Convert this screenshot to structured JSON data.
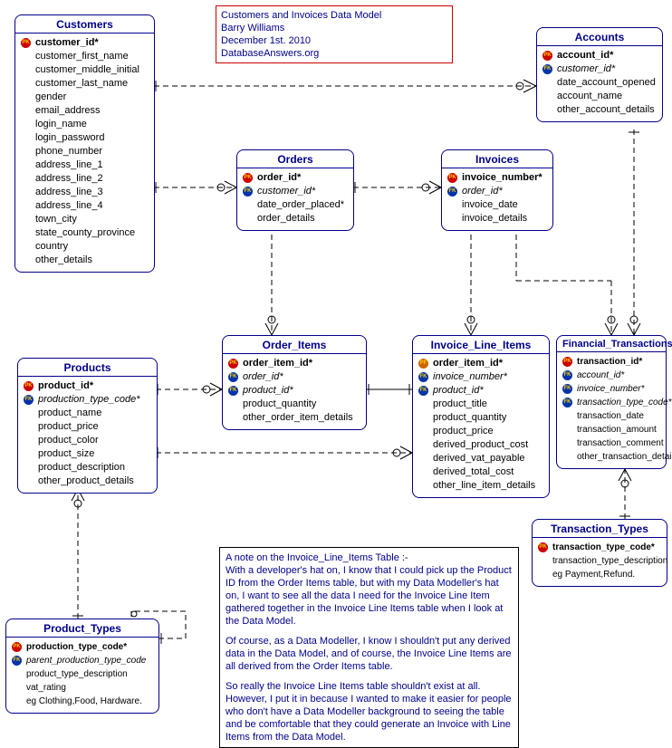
{
  "info": {
    "title": "Customers and Invoices Data Model",
    "author": "Barry Williams",
    "date": "December 1st. 2010",
    "site": "DatabaseAnswers.org"
  },
  "entities": {
    "customers": {
      "name": "Customers",
      "attrs": [
        {
          "k": "pk",
          "t": "customer_id*",
          "b": true
        },
        {
          "k": "",
          "t": "customer_first_name"
        },
        {
          "k": "",
          "t": "customer_middle_initial"
        },
        {
          "k": "",
          "t": "customer_last_name"
        },
        {
          "k": "",
          "t": "gender"
        },
        {
          "k": "",
          "t": "email_address"
        },
        {
          "k": "",
          "t": "login_name"
        },
        {
          "k": "",
          "t": "login_password"
        },
        {
          "k": "",
          "t": "phone_number"
        },
        {
          "k": "",
          "t": "address_line_1"
        },
        {
          "k": "",
          "t": "address_line_2"
        },
        {
          "k": "",
          "t": "address_line_3"
        },
        {
          "k": "",
          "t": "address_line_4"
        },
        {
          "k": "",
          "t": "town_city"
        },
        {
          "k": "",
          "t": "state_county_province"
        },
        {
          "k": "",
          "t": "country"
        },
        {
          "k": "",
          "t": "other_details"
        }
      ]
    },
    "accounts": {
      "name": "Accounts",
      "attrs": [
        {
          "k": "pk",
          "t": "account_id*",
          "b": true
        },
        {
          "k": "fk",
          "t": "customer_id*",
          "i": true
        },
        {
          "k": "",
          "t": "date_account_opened"
        },
        {
          "k": "",
          "t": "account_name"
        },
        {
          "k": "",
          "t": "other_account_details"
        }
      ]
    },
    "orders": {
      "name": "Orders",
      "attrs": [
        {
          "k": "pk",
          "t": "order_id*",
          "b": true
        },
        {
          "k": "fk",
          "t": "customer_id*",
          "i": true
        },
        {
          "k": "",
          "t": "date_order_placed*"
        },
        {
          "k": "",
          "t": "order_details"
        }
      ]
    },
    "invoices": {
      "name": "Invoices",
      "attrs": [
        {
          "k": "pk",
          "t": "invoice_number*",
          "b": true
        },
        {
          "k": "fk",
          "t": "order_id*",
          "i": true
        },
        {
          "k": "",
          "t": "invoice_date"
        },
        {
          "k": "",
          "t": "invoice_details"
        }
      ]
    },
    "products": {
      "name": "Products",
      "attrs": [
        {
          "k": "pk",
          "t": "product_id*",
          "b": true
        },
        {
          "k": "fk",
          "t": "production_type_code*",
          "i": true
        },
        {
          "k": "",
          "t": "product_name"
        },
        {
          "k": "",
          "t": "product_price"
        },
        {
          "k": "",
          "t": "product_color"
        },
        {
          "k": "",
          "t": "product_size"
        },
        {
          "k": "",
          "t": "product_description"
        },
        {
          "k": "",
          "t": "other_product_details"
        }
      ]
    },
    "order_items": {
      "name": "Order_Items",
      "attrs": [
        {
          "k": "pk",
          "t": "order_item_id*",
          "b": true
        },
        {
          "k": "fk",
          "t": "order_id*",
          "i": true
        },
        {
          "k": "fk",
          "t": "product_id*",
          "i": true
        },
        {
          "k": "",
          "t": "product_quantity"
        },
        {
          "k": "",
          "t": "other_order_item_details"
        }
      ]
    },
    "invoice_line_items": {
      "name": "Invoice_Line_Items",
      "attrs": [
        {
          "k": "pf",
          "t": "order_item_id*",
          "b": true
        },
        {
          "k": "fk",
          "t": "invoice_number*",
          "i": true
        },
        {
          "k": "fk",
          "t": "product_id*",
          "i": true
        },
        {
          "k": "",
          "t": "product_title"
        },
        {
          "k": "",
          "t": "product_quantity"
        },
        {
          "k": "",
          "t": "product_price"
        },
        {
          "k": "",
          "t": "derived_product_cost"
        },
        {
          "k": "",
          "t": "derived_vat_payable"
        },
        {
          "k": "",
          "t": "derived_total_cost"
        },
        {
          "k": "",
          "t": "other_line_item_details"
        }
      ]
    },
    "financial_transactions": {
      "name": "Financial_Transactions",
      "attrs": [
        {
          "k": "pk",
          "t": "transaction_id*",
          "b": true
        },
        {
          "k": "fk",
          "t": "account_id*",
          "i": true
        },
        {
          "k": "fk",
          "t": "invoice_number*",
          "i": true
        },
        {
          "k": "fk",
          "t": "transaction_type_code*",
          "i": true
        },
        {
          "k": "",
          "t": "transaction_date"
        },
        {
          "k": "",
          "t": "transaction_amount"
        },
        {
          "k": "",
          "t": "transaction_comment"
        },
        {
          "k": "",
          "t": "other_transaction_details"
        }
      ]
    },
    "transaction_types": {
      "name": "Transaction_Types",
      "attrs": [
        {
          "k": "pk",
          "t": "transaction_type_code*",
          "b": true
        },
        {
          "k": "",
          "t": "transaction_type_description"
        },
        {
          "k": "",
          "t": "eg Payment,Refund."
        }
      ]
    },
    "product_types": {
      "name": "Product_Types",
      "attrs": [
        {
          "k": "pk",
          "t": "production_type_code*",
          "b": true
        },
        {
          "k": "fk",
          "t": "parent_production_type_code",
          "i": true
        },
        {
          "k": "",
          "t": "product_type_description"
        },
        {
          "k": "",
          "t": "vat_rating"
        },
        {
          "k": "",
          "t": "eg Clothing,Food, Hardware."
        }
      ]
    }
  },
  "note": {
    "p1": "A note on the Invoice_Line_Items Table :-",
    "p2": "With a developer's hat on, I know that I could pick up the Product ID from the Order Items table, but with my Data Modeller's hat on, I want to see all the data I need for the Invoice Line Item gathered together in the Invoice Line Items table when I look at the Data Model.",
    "p3": "Of course, as a Data Modeller, I know I  shouldn't put any derived data in the Data Model, and of course, the Invoice Line Items are all derived from the Order Items table.",
    "p4": "So really the Invoice Line Items table shouldn't exist at all. However, I put it in because I wanted to make it easier for people who don't have a Data Modeller background to seeing the table and be comfortable that they could generate an Invoice with Line Items from the Data Model."
  }
}
